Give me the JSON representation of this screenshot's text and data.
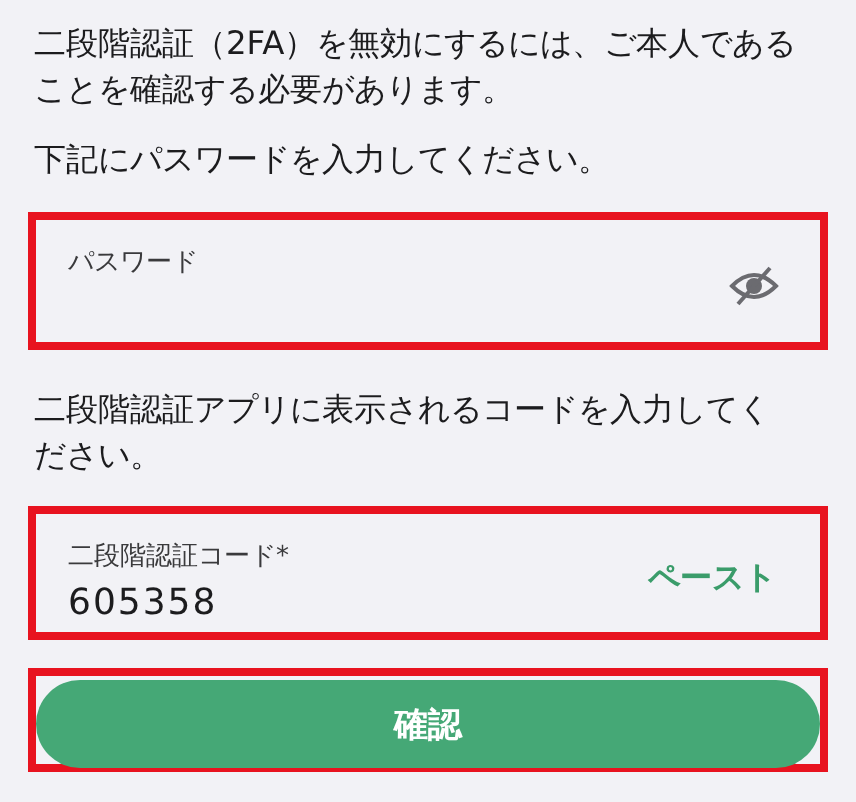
{
  "intro": "二段階認証（2FA）を無効にするには、ご本人であることを確認する必要があります。",
  "password_prompt": "下記にパスワードを入力してください。",
  "password_field": {
    "label": "パスワード",
    "highlighted": true,
    "password_visible": false
  },
  "code_prompt": "二段階認証アプリに表示されるコードを入力してください。",
  "code_field": {
    "label": "二段階認証コード*",
    "value": "605358",
    "action": "ペースト",
    "highlighted": true
  },
  "confirm_button": {
    "label": "確認",
    "highlighted": true
  }
}
